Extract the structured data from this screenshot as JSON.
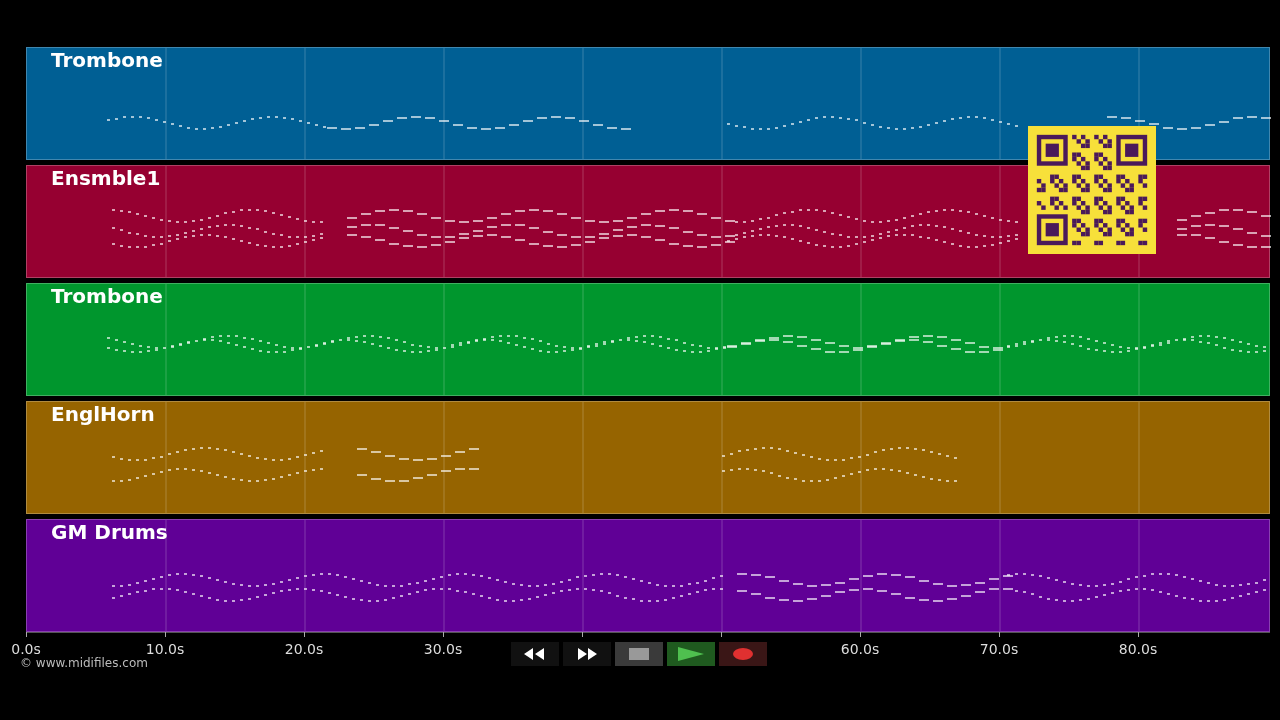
{
  "tracks": [
    {
      "name": "Trombone",
      "color": "#005f94"
    },
    {
      "name": "Ensmble1",
      "color": "#960031"
    },
    {
      "name": "Trombone",
      "color": "#00962d"
    },
    {
      "name": "EnglHorn",
      "color": "#966400"
    },
    {
      "name": "GM Drums",
      "color": "#600096"
    }
  ],
  "time_axis": {
    "ticks": [
      "0.0s",
      "10.0s",
      "20.0s",
      "30.0s",
      "60.0s",
      "70.0s",
      "80.0s"
    ]
  },
  "copyright": "© www.midifiles.com"
}
